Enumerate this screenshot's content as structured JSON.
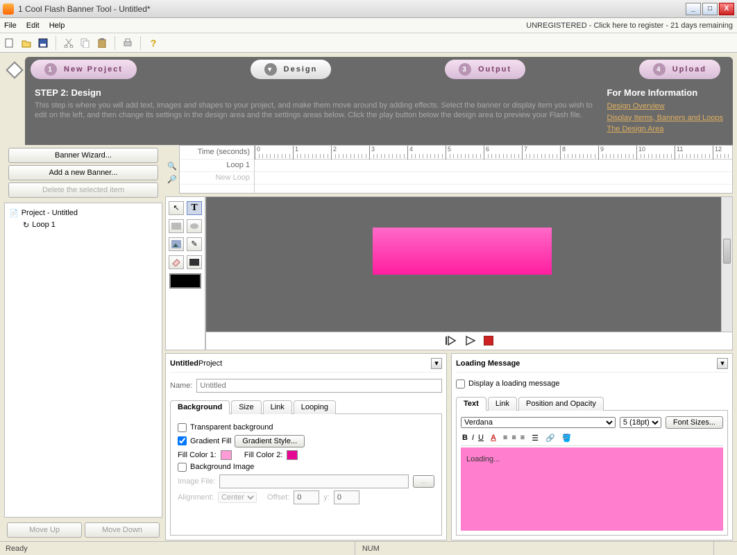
{
  "window": {
    "title": "1 Cool Flash Banner Tool - Untitled*"
  },
  "menu": {
    "file": "File",
    "edit": "Edit",
    "help": "Help",
    "register": "UNREGISTERED - Click here to register - 21 days remaining"
  },
  "wizard": {
    "tabs": [
      "New Project",
      "Design",
      "Output",
      "Upload"
    ],
    "step_title": "STEP 2: Design",
    "step_body": "This step is where you will add text, images and shapes to your project, and make them move around by adding effects.  Select the banner or display item you wish to edit on the left, and then change its settings in the design area and the settings areas below.  Click the play button below the design area to preview your Flash file.",
    "info_title": "For More Information",
    "links": [
      "Design Overview",
      "Display Items, Banners and Loops",
      "The Design Area"
    ]
  },
  "left": {
    "wizard_btn": "Banner Wizard...",
    "add_btn": "Add a new Banner...",
    "delete_btn": "Delete the selected item",
    "tree_root": "Project - Untitled",
    "tree_child": "Loop 1",
    "move_up": "Move Up",
    "move_down": "Move Down"
  },
  "timeline": {
    "hdr": "Time (seconds)",
    "row1": "Loop 1",
    "row2": "New Loop",
    "ticks": [
      "0",
      "1",
      "2",
      "3",
      "4",
      "5",
      "6",
      "7",
      "8",
      "9",
      "10",
      "11",
      "12"
    ]
  },
  "project_panel": {
    "title_b": "Untitled",
    "title_r": " Project",
    "name_label": "Name:",
    "name_placeholder": "Untitled",
    "tabs": [
      "Background",
      "Size",
      "Link",
      "Looping"
    ],
    "transparent": "Transparent background",
    "gradient": "Gradient Fill",
    "gradient_btn": "Gradient Style...",
    "fill1": "Fill Color 1:",
    "fill2": "Fill Color 2:",
    "bgimage": "Background Image",
    "imgfile": "Image File:",
    "alignment": "Alignment:",
    "align_val": "Center",
    "offset": "Offset:",
    "offx": "0",
    "offy": "0",
    "ylabel": "y:",
    "color1": "#ff9cd6",
    "color2": "#e60894"
  },
  "loading_panel": {
    "title": "Loading Message",
    "checkbox": "Display a loading message",
    "tabs": [
      "Text",
      "Link",
      "Position and Opacity"
    ],
    "font": "Verdana",
    "size": "5 (18pt)",
    "fontsizes_btn": "Font Sizes...",
    "text": "Loading..."
  },
  "status": {
    "ready": "Ready",
    "num": "NUM"
  }
}
